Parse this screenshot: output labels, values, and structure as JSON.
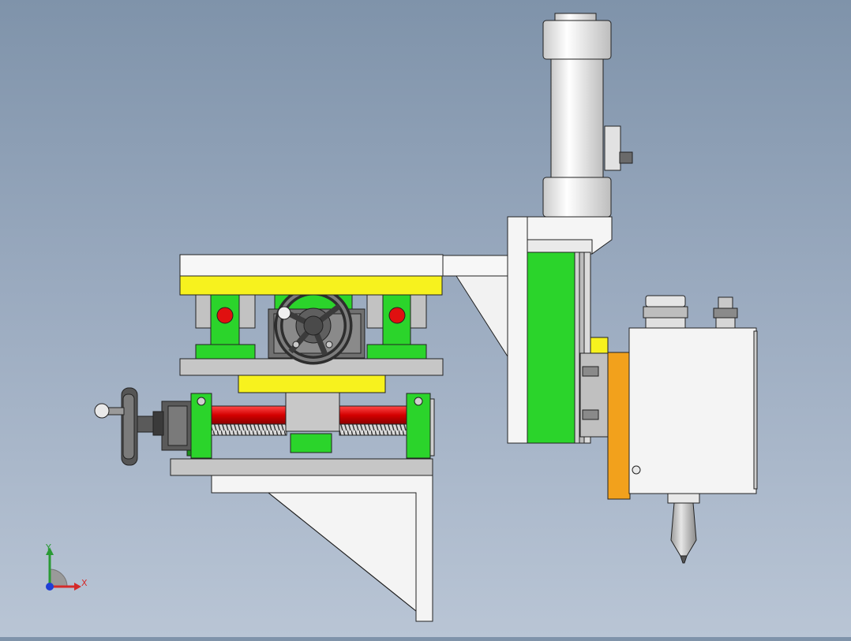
{
  "axes": {
    "x": "X",
    "y": "Y"
  },
  "colors": {
    "background_top": "#7f93aa",
    "background_bottom": "#b9c5d5",
    "frame": "#f4f4f4",
    "rail": "#c7c7c7",
    "plate_yellow": "#f7f21e",
    "block_green": "#2bd42b",
    "leadscrew_red": "#e01010",
    "mount_orange": "#f2a11c",
    "axis_x": "#d42a2a",
    "axis_y": "#2a9a35",
    "axis_z": "#1f3fd6"
  },
  "icons": [
    "handwheel-icon",
    "triad-axis-icon",
    "fitting-icon"
  ]
}
